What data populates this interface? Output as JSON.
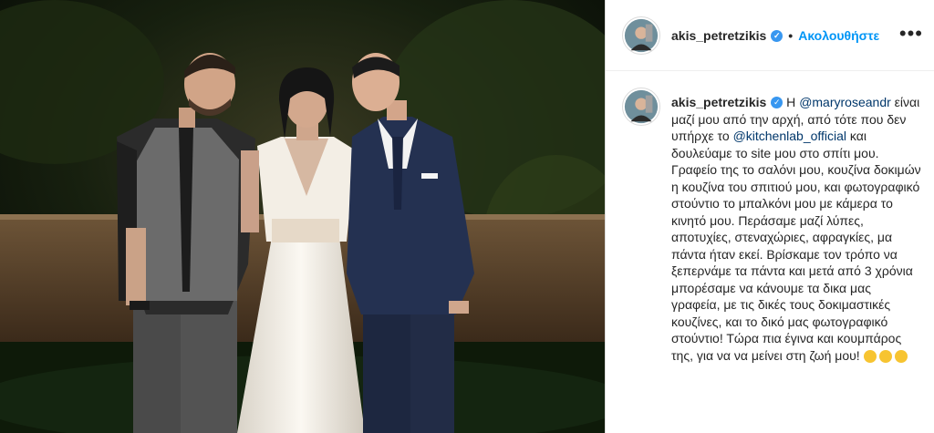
{
  "post": {
    "username": "akis_petretzikis",
    "follow_label": "Ακολουθήστε",
    "header_separator": "•",
    "more_label": "•••",
    "verified_symbol": "✓"
  },
  "caption": {
    "username": "akis_petretzikis",
    "part1": " Η ",
    "mention1": "@maryroseandr",
    "part2": " είναι μαζί μου από την αρχή, από τότε που δεν υπήρχε το ",
    "mention2": "@kitchenlab_official",
    "part3": " και δουλεύαμε το site μου στο σπίτι μου. Γραφείο της το σαλόνι μου, κουζίνα δοκιμών η κουζίνα του σπιτιού μου, και φωτογραφικό στούντιο το μπαλκόνι μου με κάμερα το κινητό μου. Περάσαμε μαζί λύπες, αποτυχίες, στεναχώριες, αφραγκίες, μα πάντα ήταν εκεί. Βρίσκαμε τον τρόπο να ξεπερνάμε τα πάντα και μετά από 3 χρόνια μπορέσαμε να κάνουμε τα δικα μας γραφεία, με τις δικές τους δοκιμαστικές κουζίνες, και το δικό μας φωτογραφικό στούντιο! Τώρα πια έγινα και κουμπάρος της, για να να μείνει στη ζωή μου!"
  },
  "colors": {
    "link": "#00376b",
    "follow": "#0095f6",
    "verified": "#3897f0",
    "text": "#262626"
  }
}
